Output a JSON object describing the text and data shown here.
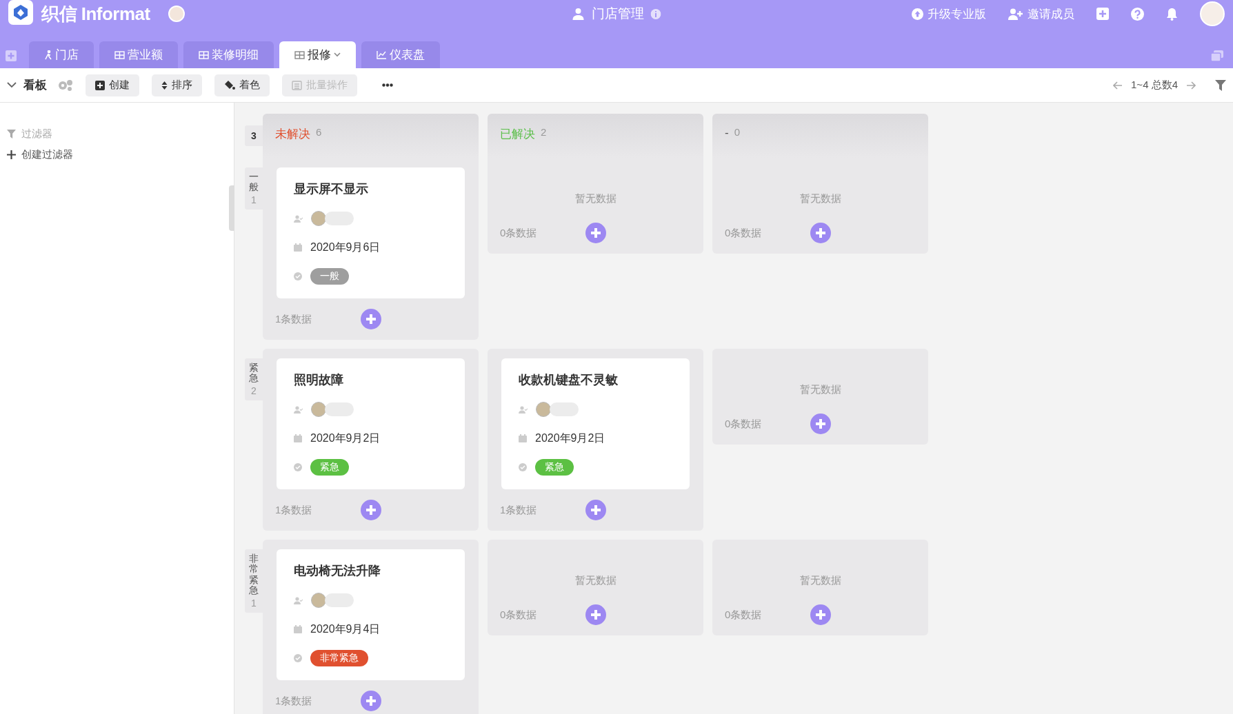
{
  "header": {
    "app_name": "织信 Informat",
    "title": "门店管理",
    "upgrade": "升级专业版",
    "invite": "邀请成员"
  },
  "tabs": [
    {
      "label": "门店",
      "kind": "person",
      "selected": false,
      "dropdown": false
    },
    {
      "label": "营业额",
      "kind": "grid",
      "selected": false,
      "dropdown": false
    },
    {
      "label": "装修明细",
      "kind": "grid",
      "selected": false,
      "dropdown": false
    },
    {
      "label": "报修",
      "kind": "grid",
      "selected": true,
      "dropdown": true
    },
    {
      "label": "仪表盘",
      "kind": "chart",
      "selected": false,
      "dropdown": false
    }
  ],
  "toolbar": {
    "view": "看板",
    "buttons": [
      {
        "label": "创建",
        "kind": "plus",
        "disabled": false
      },
      {
        "label": "排序",
        "kind": "sort",
        "disabled": false
      },
      {
        "label": "着色",
        "kind": "paint",
        "disabled": false
      },
      {
        "label": "批量操作",
        "kind": "list",
        "disabled": true
      }
    ],
    "pagination": "1~4 总数4"
  },
  "sidebar": {
    "filter_label": "过滤器",
    "create_filter": "创建过滤器"
  },
  "board": {
    "lane_count": "3",
    "columns": [
      {
        "title": "未解决",
        "count": "6",
        "color": "#e0502f"
      },
      {
        "title": "已解决",
        "count": "2",
        "color": "#5bbf4a"
      },
      {
        "title": "-",
        "count": "0",
        "color": "#555555"
      }
    ],
    "lanes": [
      {
        "label": "一般",
        "count": "1",
        "cells": [
          {
            "cards": [
              {
                "title": "显示屏不显示",
                "date": "2020年9月6日",
                "tag": {
                  "text": "一般",
                  "color": "#9e9e9e"
                }
              }
            ],
            "footer": "1条数据"
          },
          {
            "empty": "暂无数据",
            "footer": "0条数据"
          },
          {
            "empty": "暂无数据",
            "footer": "0条数据"
          }
        ]
      },
      {
        "label": "紧急",
        "count": "2",
        "cells": [
          {
            "cards": [
              {
                "title": "照明故障",
                "date": "2020年9月2日",
                "tag": {
                  "text": "紧急",
                  "color": "#5cc043"
                }
              }
            ],
            "footer": "1条数据"
          },
          {
            "cards": [
              {
                "title": "收款机键盘不灵敏",
                "date": "2020年9月2日",
                "tag": {
                  "text": "紧急",
                  "color": "#5cc043"
                }
              }
            ],
            "footer": "1条数据"
          },
          {
            "empty": "暂无数据",
            "footer": "0条数据"
          }
        ]
      },
      {
        "label": "非常紧急",
        "count": "1",
        "cells": [
          {
            "cards": [
              {
                "title": "电动椅无法升降",
                "date": "2020年9月4日",
                "tag": {
                  "text": "非常紧急",
                  "color": "#e0502f"
                }
              }
            ],
            "footer": "1条数据"
          },
          {
            "empty": "暂无数据",
            "footer": "0条数据"
          },
          {
            "empty": "暂无数据",
            "footer": "0条数据"
          }
        ]
      }
    ]
  }
}
